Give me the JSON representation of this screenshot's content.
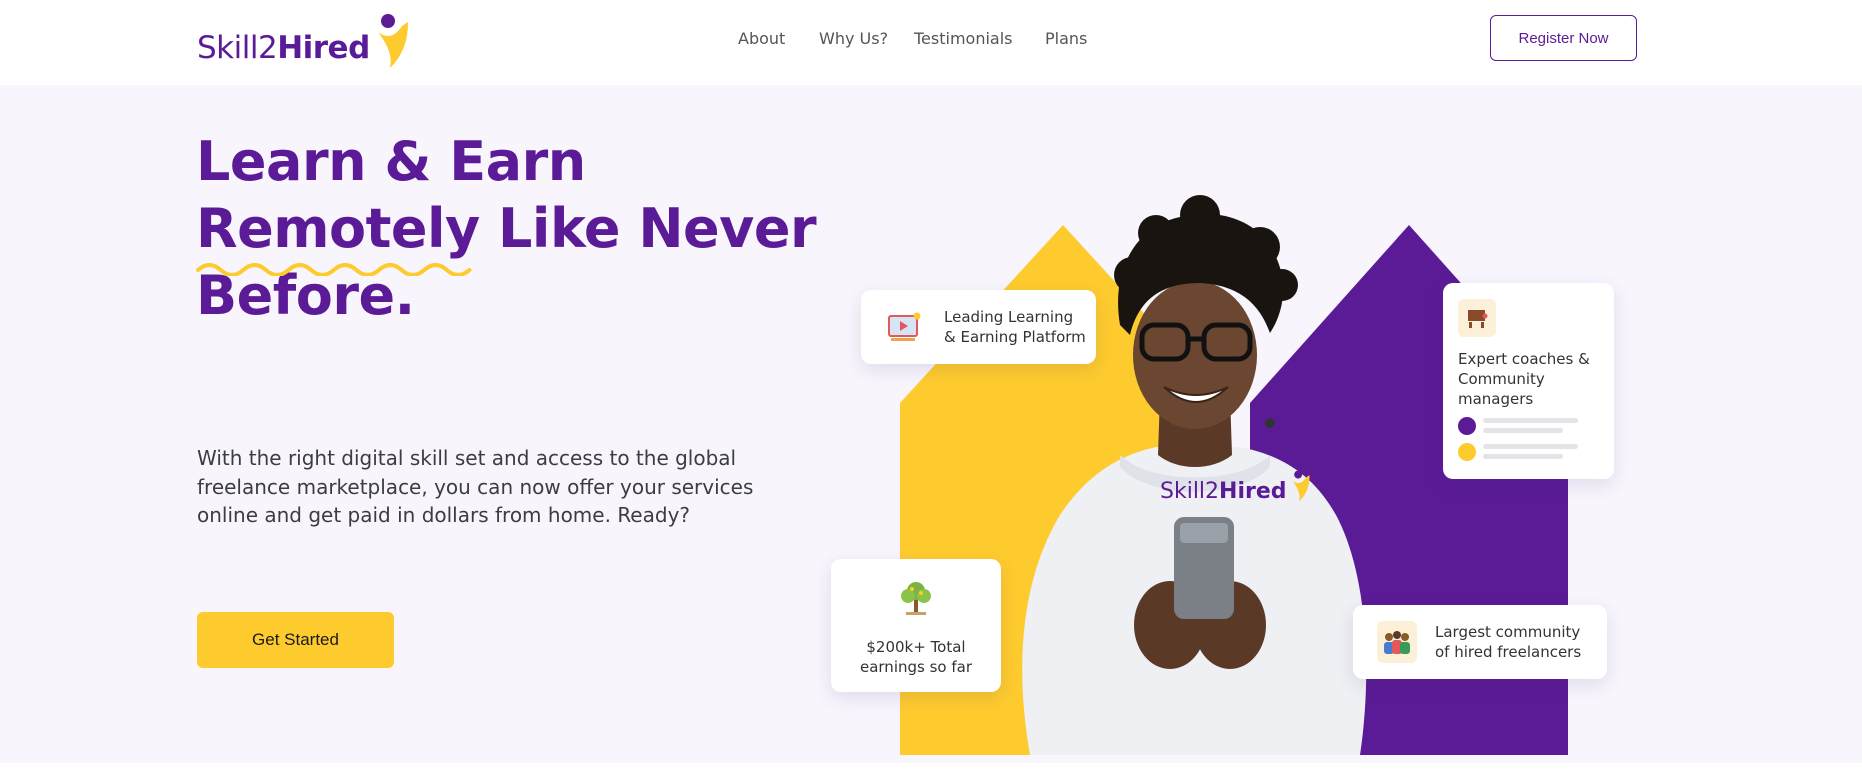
{
  "brand": {
    "name_light": "Skill2",
    "name_bold": "Hired",
    "purple": "#5b1b96",
    "yellow": "#fecb2e",
    "background": "#f8f5fd"
  },
  "nav": {
    "items": [
      {
        "label": "About"
      },
      {
        "label": "Why Us?"
      },
      {
        "label": "Testimonials"
      },
      {
        "label": "Plans"
      }
    ],
    "register_label": "Register Now"
  },
  "hero": {
    "headline_line1": "Learn & Earn",
    "headline_word_underlined": "Remotely",
    "headline_line2_rest": " Like Never",
    "headline_line3": "Before.",
    "description": "With the right digital skill set and access to the global freelance marketplace, you can now offer your services online and get paid in dollars from home. Ready?",
    "cta_label": "Get Started"
  },
  "illustration": {
    "hoodie_brand_light": "Skill2",
    "hoodie_brand_bold": "Hired",
    "cards": {
      "platform": {
        "line1": "Leading Learning",
        "line2": "& Earning Platform",
        "icon": "video-lesson-icon"
      },
      "coaches": {
        "line1": "Expert coaches &",
        "line2": "Community",
        "line3": "managers",
        "icon": "coach-board-icon"
      },
      "earnings": {
        "line1": "$200k+ Total",
        "line2": "earnings so far",
        "icon": "money-tree-icon"
      },
      "community": {
        "line1": "Largest community",
        "line2": "of hired freelancers",
        "icon": "crowd-icon"
      }
    }
  }
}
